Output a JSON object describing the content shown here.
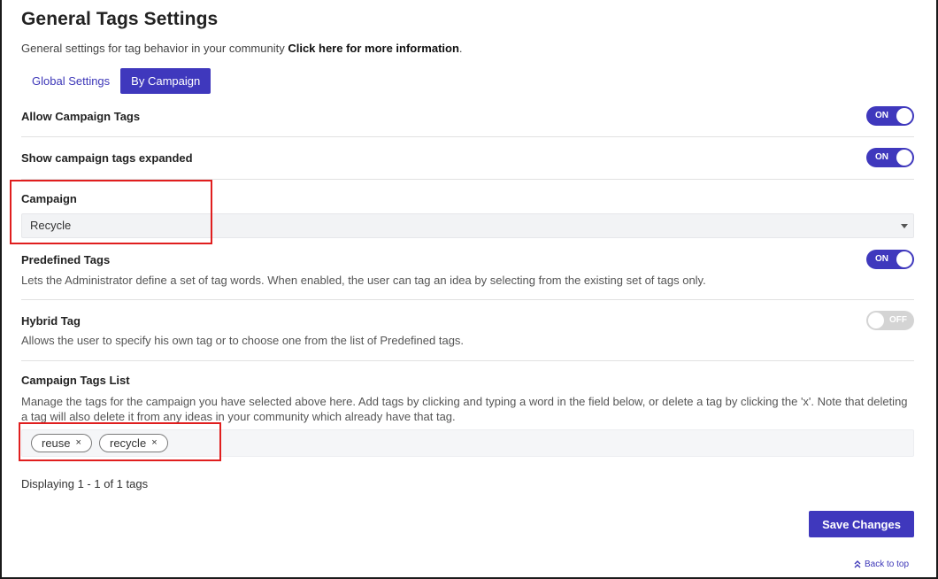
{
  "header": {
    "title": "General Tags Settings",
    "subtitle": "General settings for tag behavior in your community",
    "info_link": "Click here for more information",
    "info_suffix": "."
  },
  "tabs": [
    {
      "label": "Global Settings",
      "active": false
    },
    {
      "label": "By Campaign",
      "active": true
    }
  ],
  "settings": {
    "allow_campaign_tags": {
      "label": "Allow Campaign Tags",
      "state": "ON"
    },
    "show_expanded": {
      "label": "Show campaign tags expanded",
      "state": "ON"
    },
    "campaign": {
      "label": "Campaign",
      "selected": "Recycle"
    },
    "predefined_tags": {
      "label": "Predefined Tags",
      "description": "Lets the Administrator define a set of tag words. When enabled, the user can tag an idea by selecting from the existing set of tags only.",
      "state": "ON"
    },
    "hybrid_tag": {
      "label": "Hybrid Tag",
      "description": "Allows the user to specify his own tag or to choose one from the list of Predefined tags.",
      "state": "OFF"
    },
    "tags_list": {
      "label": "Campaign Tags List",
      "description": "Manage the tags for the campaign you have selected above here. Add tags by clicking and typing a word in the field below, or delete a tag by clicking the 'x'. Note that deleting a tag will also delete it from any ideas in your community which already have that tag.",
      "tags": [
        "reuse",
        "recycle"
      ],
      "remove_glyph": "×"
    }
  },
  "footer": {
    "displaying": "Displaying 1 - 1 of 1 tags",
    "save_label": "Save Changes",
    "back_to_top": "Back to top"
  },
  "colors": {
    "accent": "#3f38bd",
    "highlight": "#e01e1e",
    "toggle_off": "#d4d4d4"
  }
}
